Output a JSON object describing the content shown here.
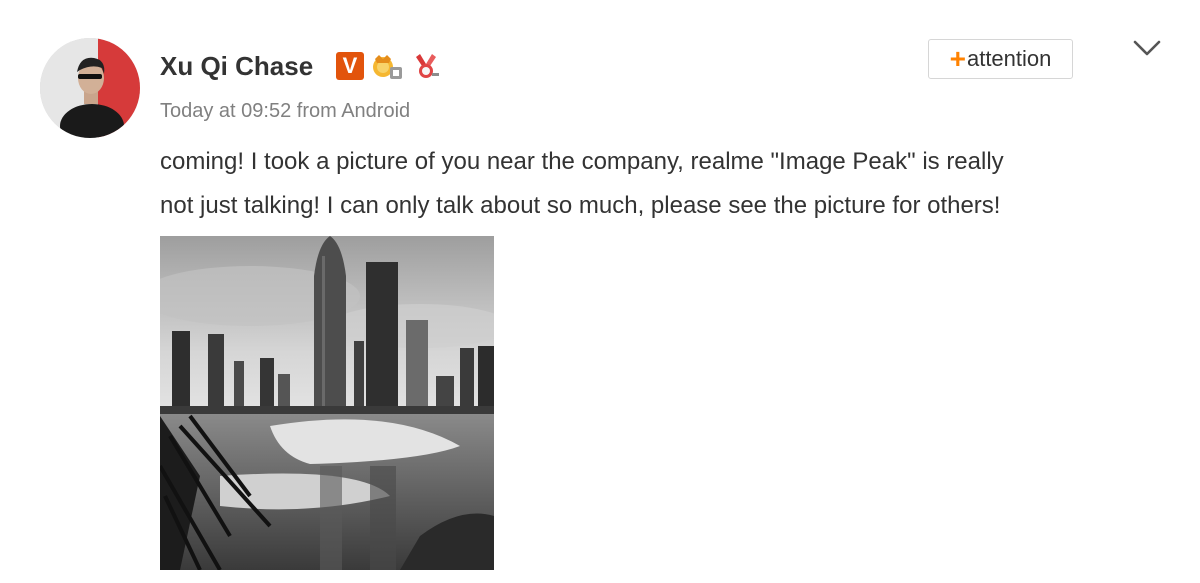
{
  "post": {
    "author": {
      "name": "Xu Qi Chase",
      "verified_badge": "V",
      "avatar_icon": "user-avatar",
      "badges": [
        "verified-v-badge",
        "vip-membership-icon",
        "medal-icon"
      ]
    },
    "meta": {
      "time_source": "Today at 09:52 from Android"
    },
    "follow_button": {
      "plus": "+",
      "label": "attention"
    },
    "menu_icon": "chevron-down-icon",
    "content": {
      "line1": "coming! I took a picture of you near the company, realme \"Image Peak\" is really",
      "line2": "not just talking! I can only talk about so much, please see the picture for others!"
    },
    "image": {
      "subject": "black-and-white city skyline photo"
    },
    "colors": {
      "accent": "#ff8200",
      "verified_badge": "#e2540c",
      "text": "#333333",
      "meta_text": "#808080"
    }
  }
}
